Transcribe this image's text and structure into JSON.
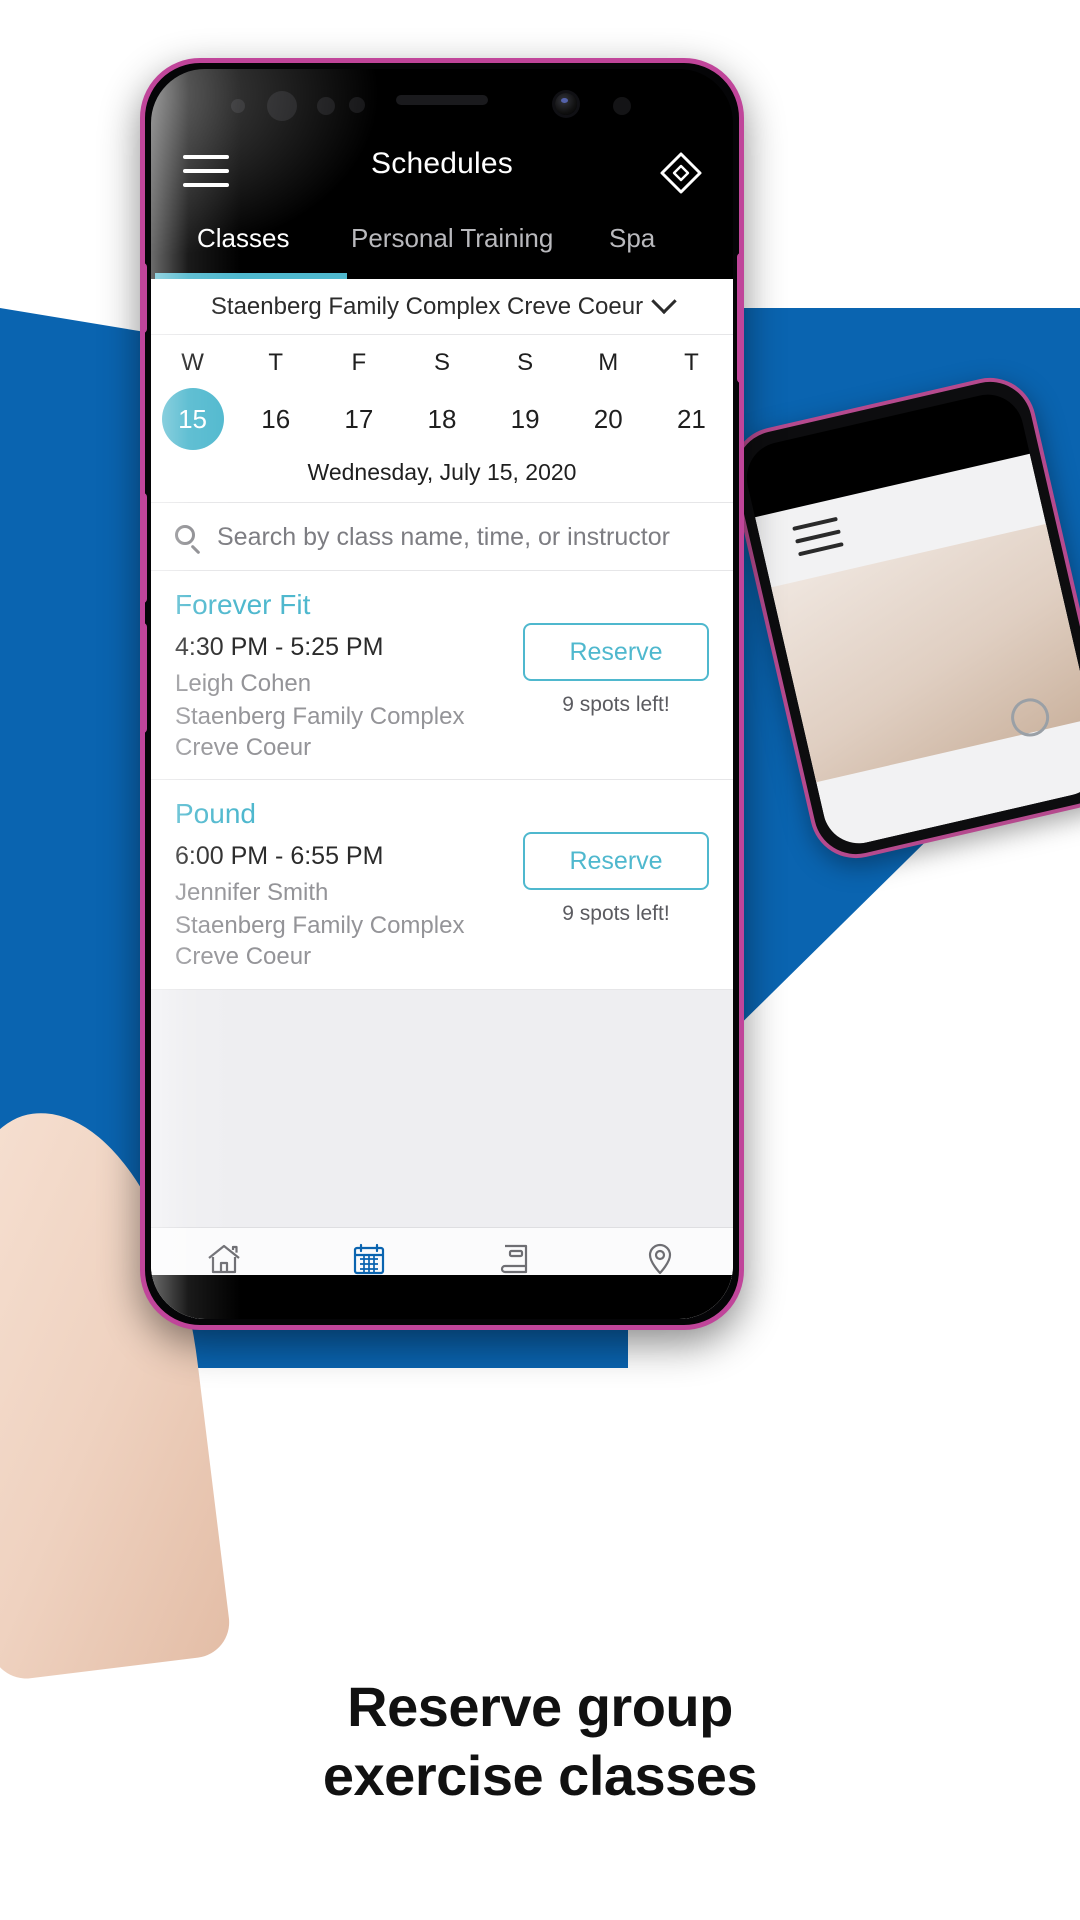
{
  "app": {
    "title": "Schedules",
    "menu_icon": "hamburger-menu-icon",
    "action_icon": "ticket-tag-icon"
  },
  "tabs": [
    {
      "label": "Classes",
      "active": true
    },
    {
      "label": "Personal Training",
      "active": false
    },
    {
      "label": "Spa",
      "active": false
    }
  ],
  "location": {
    "name": "Staenberg Family Complex Creve Coeur",
    "chevron": "chevron-down-icon"
  },
  "week": {
    "weekday_initials": [
      "W",
      "T",
      "F",
      "S",
      "S",
      "M",
      "T"
    ],
    "day_numbers": [
      "15",
      "16",
      "17",
      "18",
      "19",
      "20",
      "21"
    ],
    "selected_index": 0,
    "full_date": "Wednesday, July 15, 2020"
  },
  "search": {
    "icon": "search-icon",
    "placeholder": "Search by class name, time, or instructor",
    "value": ""
  },
  "classes": [
    {
      "name": "Forever Fit",
      "time": "4:30 PM - 5:25 PM",
      "instructor": "Leigh Cohen",
      "location": "Staenberg Family Complex Creve Coeur",
      "reserve_label": "Reserve",
      "spots": "9 spots left!"
    },
    {
      "name": "Pound",
      "time": "6:00 PM - 6:55 PM",
      "instructor": "Jennifer Smith",
      "location": "Staenberg Family Complex Creve Coeur",
      "reserve_label": "Reserve",
      "spots": "9 spots left!"
    }
  ],
  "bottom_nav": [
    {
      "label": "Home",
      "icon": "home-icon",
      "active": false
    },
    {
      "label": "Schedules",
      "icon": "calendar-icon",
      "active": true
    },
    {
      "label": "Reservations",
      "icon": "book-icon",
      "active": false
    },
    {
      "label": "Facilities",
      "icon": "map-pin-icon",
      "active": false
    }
  ],
  "caption": {
    "line1": "Reserve group",
    "line2": "exercise classes"
  },
  "colors": {
    "accent_teal": "#4fb8ce",
    "brand_blue": "#0a64b0",
    "phone_frame": "#c0459a",
    "muted_text": "#949498"
  }
}
